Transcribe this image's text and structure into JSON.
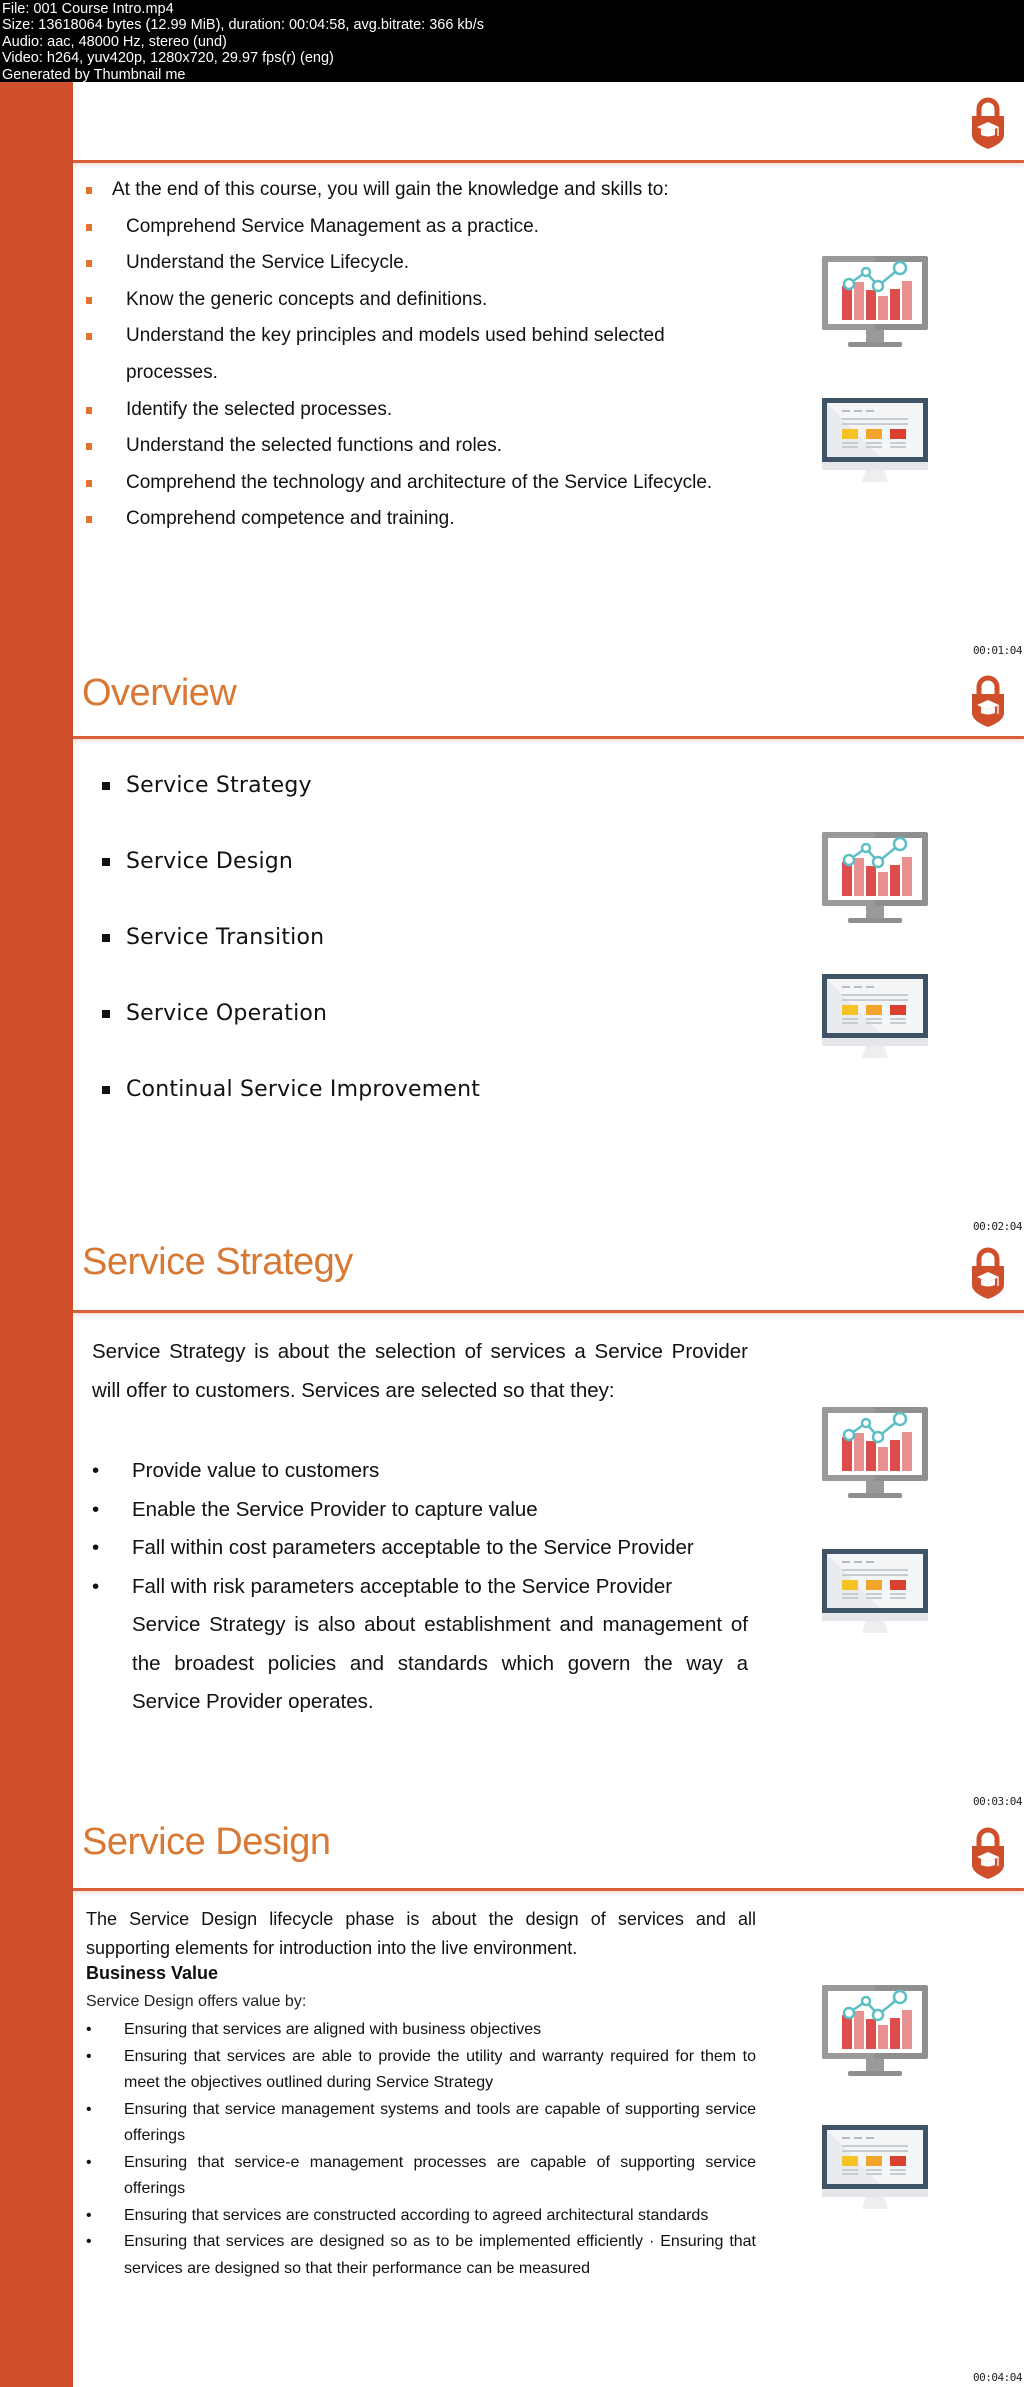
{
  "file_info": {
    "lines": [
      "File: 001 Course Intro.mp4",
      "Size: 13618064 bytes (12.99 MiB), duration: 00:04:58, avg.bitrate: 366 kb/s",
      "Audio: aac, 48000 Hz, stereo (und)",
      "Video: h264, yuv420p, 1280x720, 29.97 fps(r) (eng)",
      "Generated by Thumbnail me"
    ]
  },
  "colors": {
    "sidebar": "#cf4f2b",
    "title": "#d77934",
    "rule": "#d8603a",
    "bullet_square": "#e0742f",
    "lock": "#cf4f2b"
  },
  "icons": {
    "lock": "lock-graduation-cap-icon",
    "monitor_chart": "monitor-chart-icon",
    "monitor_web": "monitor-webpage-icon"
  },
  "slides": [
    {
      "title": "",
      "timestamp": "00:01:04",
      "lead": "At the end of this course, you will gain the knowledge and skills to:",
      "items": [
        "Comprehend Service Management as a practice.",
        "Understand the Service Lifecycle.",
        "Know the generic concepts and definitions.",
        "Understand the key principles and models used behind selected processes.",
        "Identify the selected processes.",
        "Understand the selected functions and roles.",
        "Comprehend the technology and architecture of the Service Lifecycle.",
        "Comprehend competence and training."
      ]
    },
    {
      "title": "Overview",
      "timestamp": "00:02:04",
      "items": [
        "Service Strategy",
        "Service Design",
        "Service Transition",
        "Service Operation",
        "Continual Service Improvement"
      ]
    },
    {
      "title": "Service Strategy",
      "timestamp": "00:03:04",
      "bullet_glyph": "•",
      "intro": "Service Strategy is about the selection of services a Service Provider will offer to customers. Services are selected so that they:",
      "items": [
        "Provide value to customers",
        "Enable the Service Provider to capture value",
        "Fall within cost parameters acceptable to the Service Provider",
        "Fall with risk parameters acceptable to the Service Provider"
      ],
      "tail": "Service Strategy  is also about establishment and management of the broadest policies and standards which govern the way a Service Provider operates."
    },
    {
      "title": "Service Design",
      "timestamp": "00:04:04",
      "bullet_glyph": "•",
      "intro": "The Service Design lifecycle phase is about the design of services and all supporting elements for introduction into the live environment.",
      "subheading": "Business Value",
      "subtext": "Service Design offers value by:",
      "items": [
        "Ensuring that services are aligned with business objectives",
        "Ensuring that services are able to provide the utility and warranty required for them to meet the objectives outlined during Service Strategy",
        "Ensuring that service management systems and tools are capable of supporting service offerings",
        "Ensuring that service-e management processes are capable of supporting service offerings",
        "Ensuring that services are constructed according to agreed architectural standards",
        "Ensuring that services are designed so as to be implemented efficiently · Ensuring that services are designed so that their performance can be measured"
      ]
    }
  ]
}
